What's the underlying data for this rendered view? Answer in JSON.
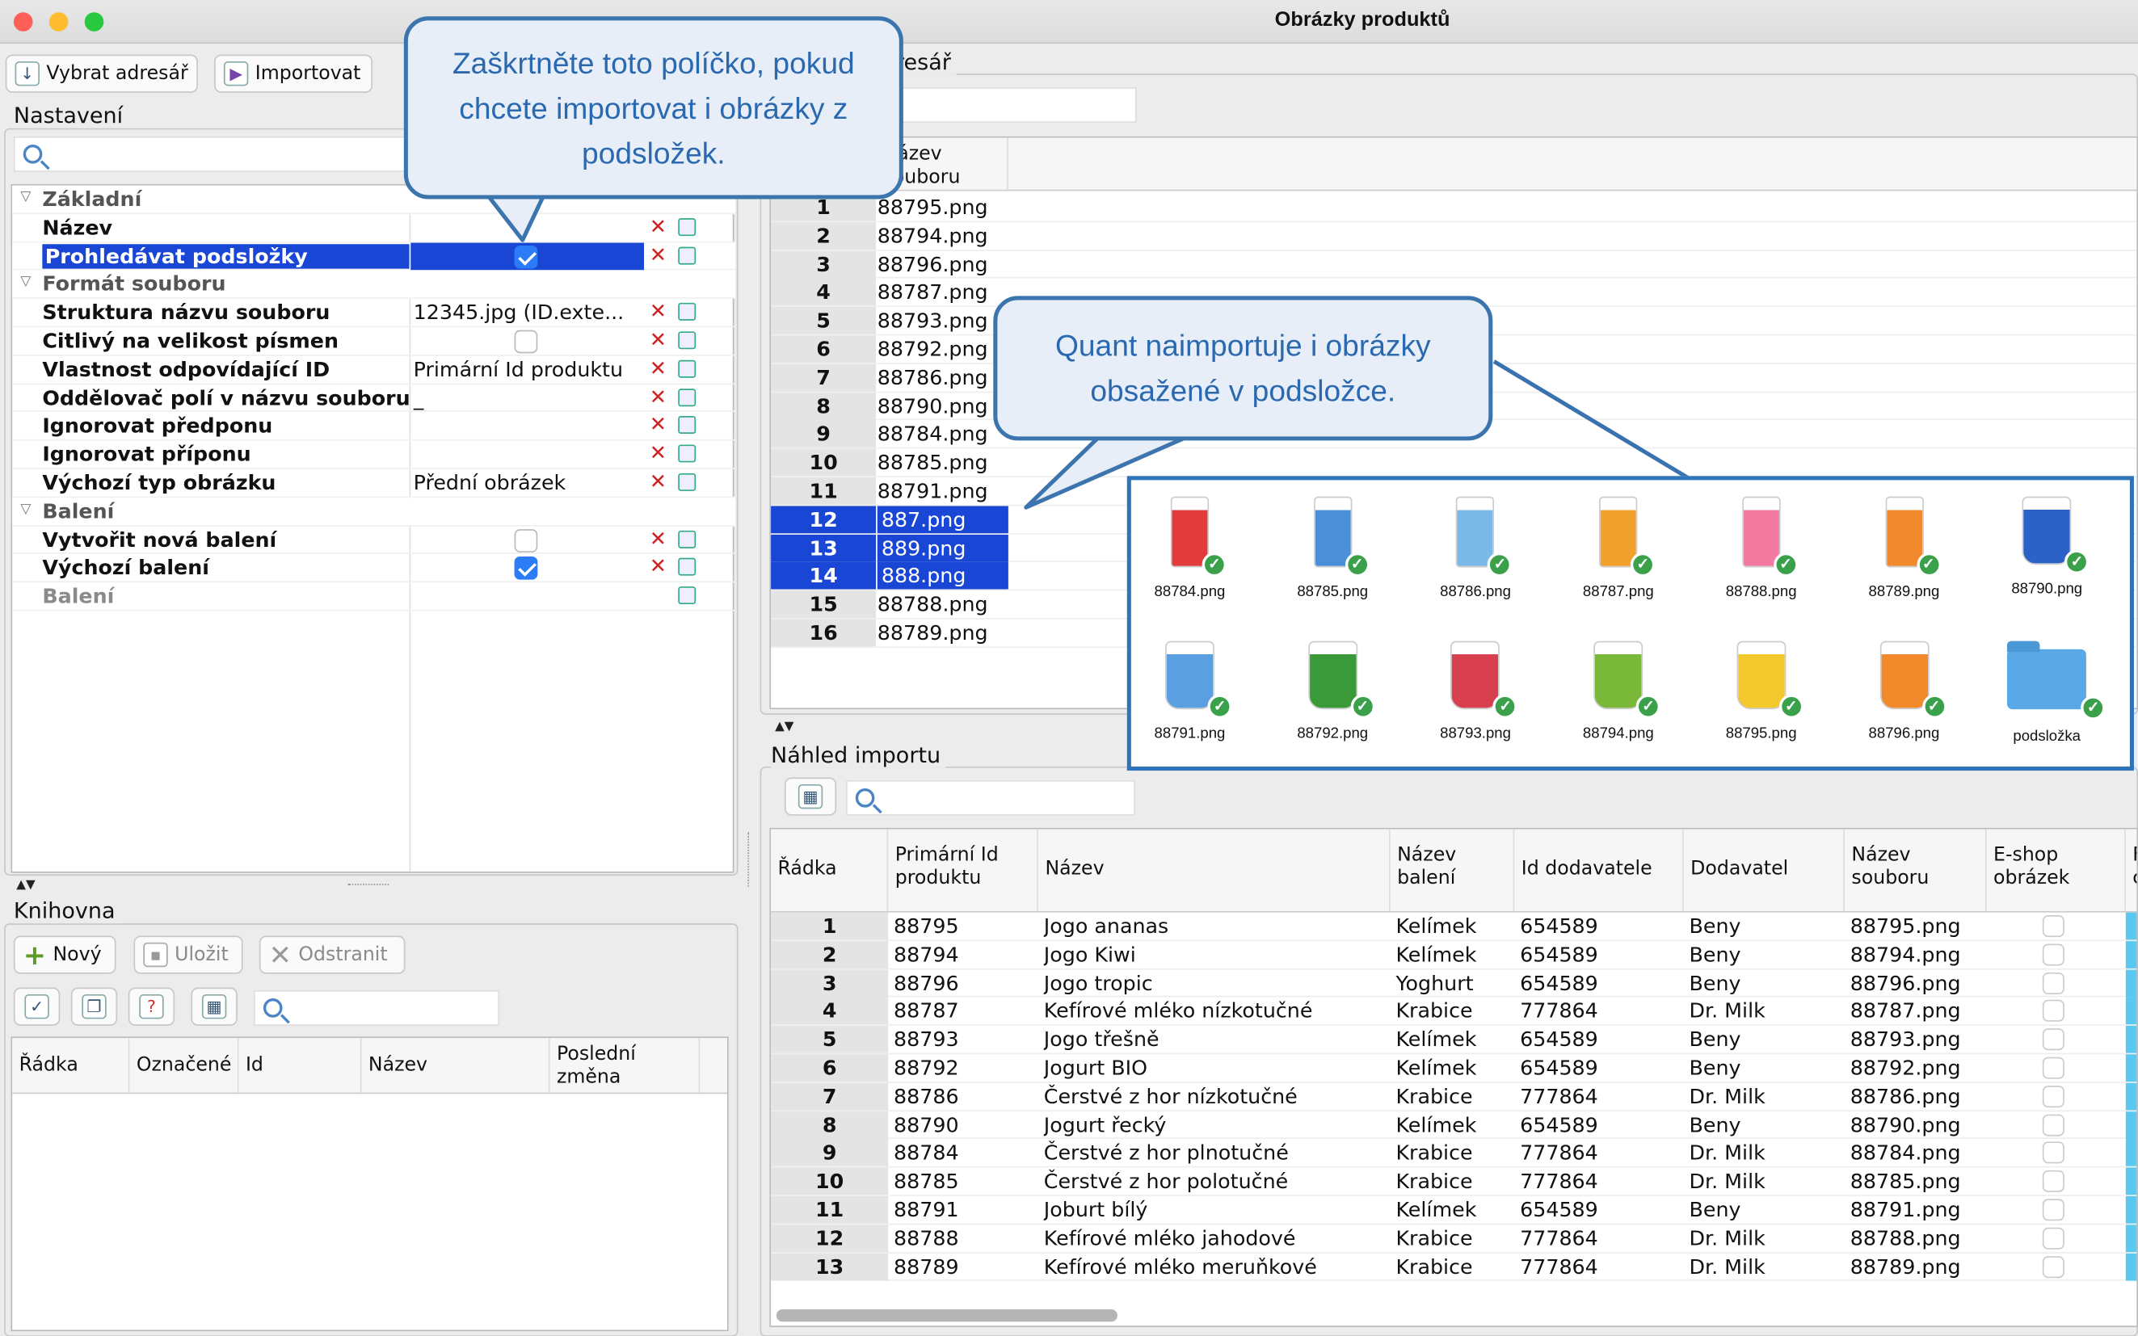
{
  "window": {
    "title": "Obrázky produktů"
  },
  "toolbar": {
    "select_dir": "Vybrat adresář",
    "import": "Importovat"
  },
  "right_group_title": "Vybraný adresář",
  "settings": {
    "title": "Nastavení",
    "rows": [
      {
        "type": "cat",
        "key": "Základní"
      },
      {
        "type": "prop",
        "key": "Název",
        "value": ""
      },
      {
        "type": "prop",
        "key": "Prohledávat podsložky",
        "value": "",
        "checkbox": true,
        "checked": true,
        "selected": true
      },
      {
        "type": "cat",
        "key": "Formát souboru"
      },
      {
        "type": "prop",
        "key": "Struktura názvu souboru",
        "value": "12345.jpg (ID.exte..."
      },
      {
        "type": "prop",
        "key": "Citlivý na velikost písmen",
        "value": "",
        "checkbox": true,
        "checked": false
      },
      {
        "type": "prop",
        "key": "Vlastnost odpovídající ID",
        "value": "Primární Id produktu"
      },
      {
        "type": "prop",
        "key": "Oddělovač polí v názvu souboru",
        "value": "_"
      },
      {
        "type": "prop",
        "key": "Ignorovat předponu",
        "value": ""
      },
      {
        "type": "prop",
        "key": "Ignorovat příponu",
        "value": ""
      },
      {
        "type": "prop",
        "key": "Výchozí typ obrázku",
        "value": "Přední obrázek"
      },
      {
        "type": "cat",
        "key": "Balení"
      },
      {
        "type": "prop",
        "key": "Vytvořit nová balení",
        "value": "",
        "checkbox": true,
        "checked": false
      },
      {
        "type": "prop",
        "key": "Výchozí balení",
        "value": "",
        "checkbox": true,
        "checked": true
      },
      {
        "type": "prop",
        "key": "Balení",
        "value": "",
        "disabled": true
      }
    ]
  },
  "library": {
    "title": "Knihovna",
    "new": "Nový",
    "save": "Uložit",
    "remove": "Odstranit",
    "columns": [
      "Řádka",
      "Označené",
      "Id",
      "Název",
      "Poslední změna"
    ]
  },
  "files": {
    "column": "Název souboru",
    "rows": [
      "88795.png",
      "88794.png",
      "88796.png",
      "88787.png",
      "88793.png",
      "88792.png",
      "88786.png",
      "88790.png",
      "88784.png",
      "88785.png",
      "88791.png",
      "887.png",
      "889.png",
      "888.png",
      "88788.png",
      "88789.png"
    ],
    "highlighted": [
      12,
      13,
      14
    ]
  },
  "callouts": {
    "subfolders": "Zaškrtněte toto políčko, pokud chcete importovat i obrázky z podsložek.",
    "quant": "Quant naimportuje i obrázky obsažené v podsložce."
  },
  "thumbs": [
    {
      "name": "88784.png",
      "color": "#e23b3b"
    },
    {
      "name": "88785.png",
      "color": "#4a8fd8"
    },
    {
      "name": "88786.png",
      "color": "#7ab8e8"
    },
    {
      "name": "88787.png",
      "color": "#f2a22c"
    },
    {
      "name": "88788.png",
      "color": "#f27aa0"
    },
    {
      "name": "88789.png",
      "color": "#f08a2c"
    },
    {
      "name": "88790.png",
      "color": "#2a62c8"
    },
    {
      "name": "88791.png",
      "color": "#5aa0e0"
    },
    {
      "name": "88792.png",
      "color": "#3a9a3a"
    },
    {
      "name": "88793.png",
      "color": "#d84050"
    },
    {
      "name": "88794.png",
      "color": "#7ab83a"
    },
    {
      "name": "88795.png",
      "color": "#f2c82c"
    },
    {
      "name": "88796.png",
      "color": "#f28a2c"
    },
    {
      "name": "podsložka",
      "folder": true
    }
  ],
  "preview": {
    "title": "Náhled importu",
    "columns": [
      "Řádka",
      "Primární Id produktu",
      "Název",
      "Název balení",
      "Id dodavatele",
      "Dodavatel",
      "Název souboru",
      "E-shop obrázek",
      "F c"
    ],
    "rows": [
      [
        "1",
        "88795",
        "Jogo ananas",
        "Kelímek",
        "654589",
        "Beny",
        "88795.png"
      ],
      [
        "2",
        "88794",
        "Jogo Kiwi",
        "Kelímek",
        "654589",
        "Beny",
        "88794.png"
      ],
      [
        "3",
        "88796",
        "Jogo tropic",
        "Yoghurt",
        "654589",
        "Beny",
        "88796.png"
      ],
      [
        "4",
        "88787",
        "Kefírové mléko nízkotučné",
        "Krabice",
        "777864",
        "Dr. Milk",
        "88787.png"
      ],
      [
        "5",
        "88793",
        "Jogo třešně",
        "Kelímek",
        "654589",
        "Beny",
        "88793.png"
      ],
      [
        "6",
        "88792",
        "Jogurt BIO",
        "Kelímek",
        "654589",
        "Beny",
        "88792.png"
      ],
      [
        "7",
        "88786",
        "Čerstvé z hor nízkotučné",
        "Krabice",
        "777864",
        "Dr. Milk",
        "88786.png"
      ],
      [
        "8",
        "88790",
        "Jogurt řecký",
        "Kelímek",
        "654589",
        "Beny",
        "88790.png"
      ],
      [
        "9",
        "88784",
        "Čerstvé z hor plnotučné",
        "Krabice",
        "777864",
        "Dr. Milk",
        "88784.png"
      ],
      [
        "10",
        "88785",
        "Čerstvé z hor polotučné",
        "Krabice",
        "777864",
        "Dr. Milk",
        "88785.png"
      ],
      [
        "11",
        "88791",
        "Joburt bílý",
        "Kelímek",
        "654589",
        "Beny",
        "88791.png"
      ],
      [
        "12",
        "88788",
        "Kefírové mléko jahodové",
        "Krabice",
        "777864",
        "Dr. Milk",
        "88788.png"
      ],
      [
        "13",
        "88789",
        "Kefírové mléko meruňkové",
        "Krabice",
        "777864",
        "Dr. Milk",
        "88789.png"
      ]
    ]
  }
}
